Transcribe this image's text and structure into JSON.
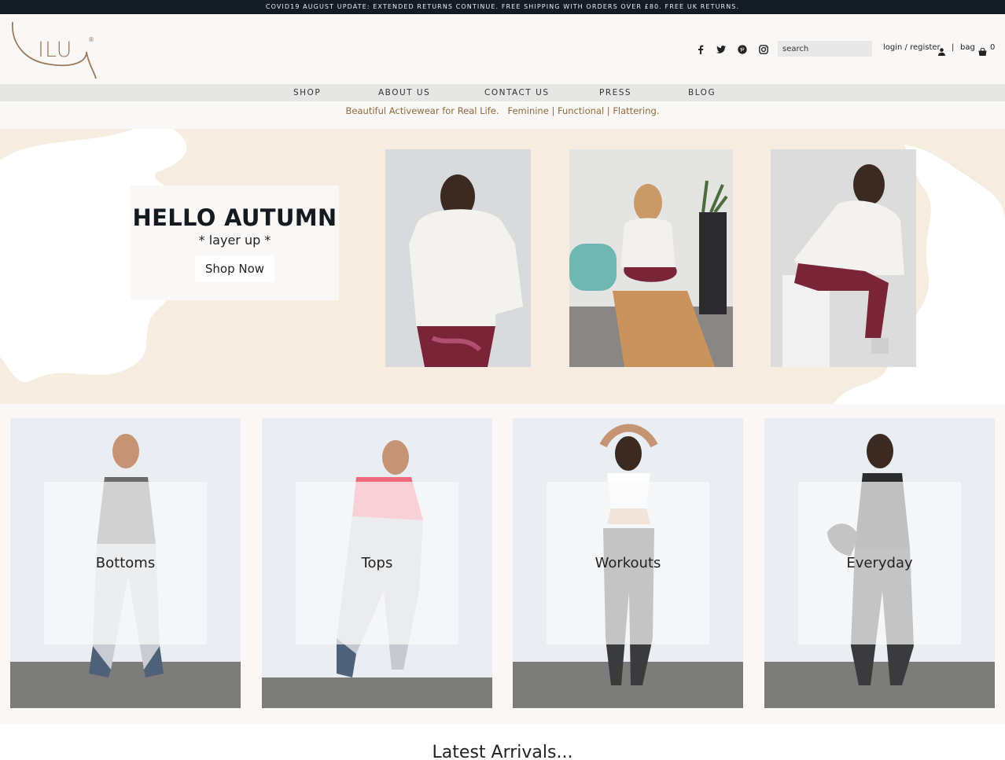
{
  "announcement": "COVID19 AUGUST UPDATE: EXTENDED RETURNS CONTINUE. FREE SHIPPING WITH ORDERS OVER £80. FREE UK RETURNS.",
  "brand": {
    "logo_text": "ILU",
    "registered_mark": "®"
  },
  "header": {
    "social_icons": [
      "facebook-icon",
      "twitter-icon",
      "pinterest-icon",
      "instagram-icon"
    ],
    "search_placeholder": "search",
    "login_label": "login / register",
    "separator": "|",
    "bag_label": "bag",
    "bag_count": "0"
  },
  "nav": {
    "items": [
      "SHOP",
      "ABOUT US",
      "CONTACT US",
      "PRESS",
      "BLOG"
    ]
  },
  "tagline": "Beautiful Activewear for Real Life.   Feminine | Functional | Flattering.",
  "hero": {
    "title": "HELLO AUTUMN",
    "subtitle": "* layer up *",
    "button_label": "Shop Now"
  },
  "categories": [
    {
      "label": "Bottoms"
    },
    {
      "label": "Tops"
    },
    {
      "label": "Workouts"
    },
    {
      "label": "Everyday"
    }
  ],
  "latest_title": "Latest Arrivals...",
  "colors": {
    "announcement_bg": "#131c24",
    "brand_gold": "#9a7a5f",
    "tagline": "#8e6a3e",
    "hero_bg": "#f6ede0",
    "nav_bg": "#e6e6e5"
  }
}
